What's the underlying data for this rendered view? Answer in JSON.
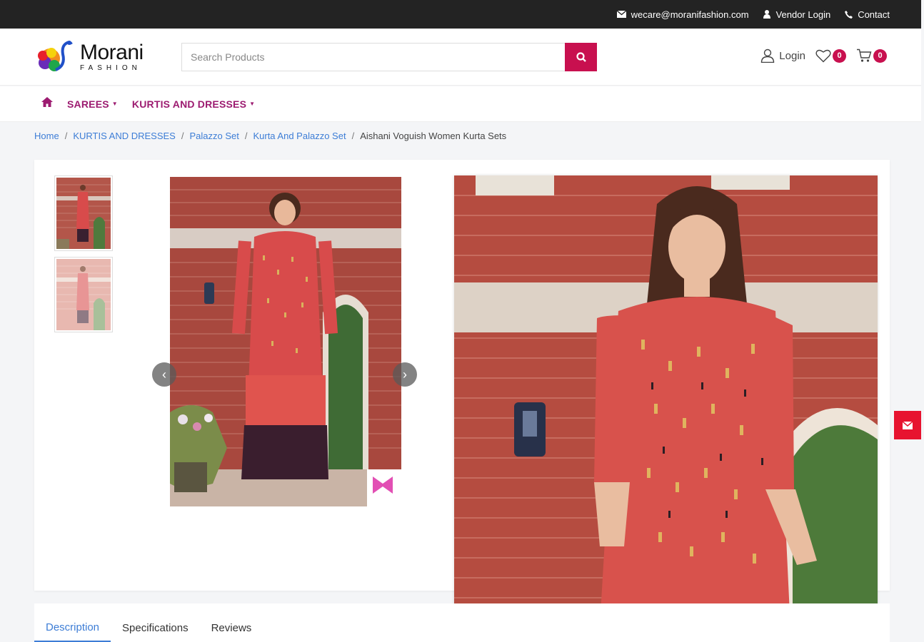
{
  "topbar": {
    "email": "wecare@moranifashion.com",
    "vendor_login": "Vendor Login",
    "contact": "Contact"
  },
  "header": {
    "logo_name": "Morani",
    "logo_sub": "FASHION",
    "search_placeholder": "Search Products",
    "login": "Login",
    "wishlist_count": "0",
    "cart_count": "0"
  },
  "nav": {
    "items": [
      {
        "label": "SAREES"
      },
      {
        "label": "KURTIS AND DRESSES"
      }
    ]
  },
  "breadcrumb": {
    "items": [
      {
        "label": "Home"
      },
      {
        "label": "KURTIS AND DRESSES"
      },
      {
        "label": "Palazzo Set"
      },
      {
        "label": "Kurta And Palazzo Set"
      }
    ],
    "current": "Aishani Voguish Women Kurta Sets"
  },
  "tabs": [
    {
      "label": "Description",
      "active": true
    },
    {
      "label": "Specifications",
      "active": false
    },
    {
      "label": "Reviews",
      "active": false
    }
  ],
  "colors": {
    "accent": "#c8104f",
    "nav": "#9c1b70",
    "link": "#3d7dd6",
    "topbar": "#232323",
    "float_button": "#e7132f"
  }
}
